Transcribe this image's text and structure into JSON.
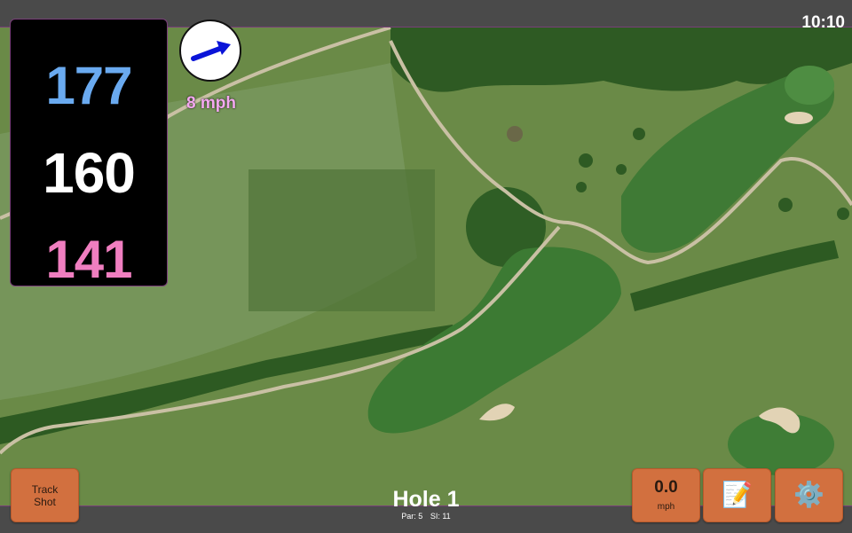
{
  "status_bar": {
    "time": "10:10"
  },
  "distances": {
    "back": "177",
    "middle": "160",
    "front": "141"
  },
  "wind": {
    "speed": "8 mph",
    "direction_icon": "arrow-up-right-icon"
  },
  "hole": {
    "title": "Hole 1",
    "par": "Par: 5",
    "si": "SI: 11"
  },
  "buttons": {
    "track_shot": {
      "line1": "Track",
      "line2": "Shot"
    },
    "speed": {
      "value": "0.0",
      "unit": "mph"
    },
    "notes_icon": "📝",
    "settings_icon": "⚙️"
  },
  "colors": {
    "back_distance": "#6aaaf0",
    "middle_distance": "#ffffff",
    "front_distance": "#f07ec0",
    "wind_text": "#f4a8f0",
    "button": "#d2703f"
  }
}
